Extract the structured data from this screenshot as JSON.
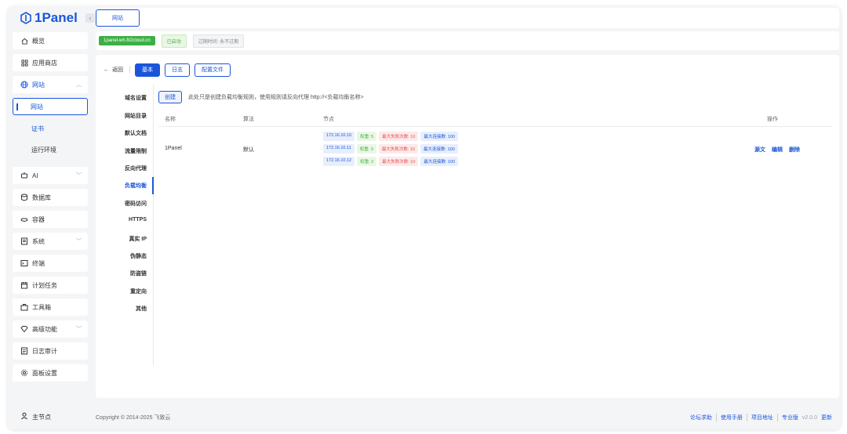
{
  "app": {
    "logo": "1Panel"
  },
  "sidebar": {
    "items": [
      {
        "label": "概览",
        "icon": "home-icon"
      },
      {
        "label": "应用商店",
        "icon": "grid-icon"
      },
      {
        "label": "网站",
        "icon": "globe-icon"
      },
      {
        "label": "网站"
      },
      {
        "label": "证书"
      },
      {
        "label": "运行环境"
      },
      {
        "label": "AI",
        "icon": "robot-icon"
      },
      {
        "label": "数据库",
        "icon": "database-icon"
      },
      {
        "label": "容器",
        "icon": "container-icon"
      },
      {
        "label": "系统",
        "icon": "system-icon"
      },
      {
        "label": "终端",
        "icon": "terminal-icon"
      },
      {
        "label": "计划任务",
        "icon": "calendar-icon"
      },
      {
        "label": "工具箱",
        "icon": "toolbox-icon"
      },
      {
        "label": "高级功能",
        "icon": "diamond-icon"
      },
      {
        "label": "日志审计",
        "icon": "log-icon"
      },
      {
        "label": "面板设置",
        "icon": "gear-icon"
      }
    ],
    "footer": "主节点"
  },
  "topbar": {
    "tab": "网站"
  },
  "infobar": {
    "site": "1panel-wh.fit2cloud.cn",
    "status": "已启动",
    "expire": "过期时间: 永不过期"
  },
  "panel": {
    "back": "返回",
    "tabs": [
      "基本",
      "日志",
      "配置文件"
    ],
    "menu": [
      "域名设置",
      "网站目录",
      "默认文档",
      "流量限制",
      "反向代理",
      "负载均衡",
      "密码访问",
      "HTTPS",
      "真实 IP",
      "伪静态",
      "防盗链",
      "重定向",
      "其他"
    ],
    "create": "创建",
    "hint": "此处只是创建负载均衡规则，使用规则请反向代理 http://<负载均衡名称>",
    "columns": [
      "名称",
      "算法",
      "节点",
      "操作"
    ],
    "row": {
      "name": "1Panel",
      "algo": "默认",
      "nodes": [
        {
          "ip": "172.16.10.10",
          "weight": "权重: 5",
          "fail": "最大失败次数: 10",
          "conn": "最大连接数: 100"
        },
        {
          "ip": "172.16.10.11",
          "weight": "权重: 3",
          "fail": "最大失败次数: 10",
          "conn": "最大连接数: 100"
        },
        {
          "ip": "172.16.10.12",
          "weight": "权重: 2",
          "fail": "最大失败次数: 10",
          "conn": "最大连接数: 100"
        }
      ],
      "ops": [
        "源文",
        "编辑",
        "删除"
      ]
    }
  },
  "footer": {
    "copyright": "Copyright © 2014-2025 飞致云",
    "links": [
      "论坛求助",
      "使用手册",
      "项目地址",
      "专业版"
    ],
    "version": "v2.0.0",
    "update": "更新"
  }
}
